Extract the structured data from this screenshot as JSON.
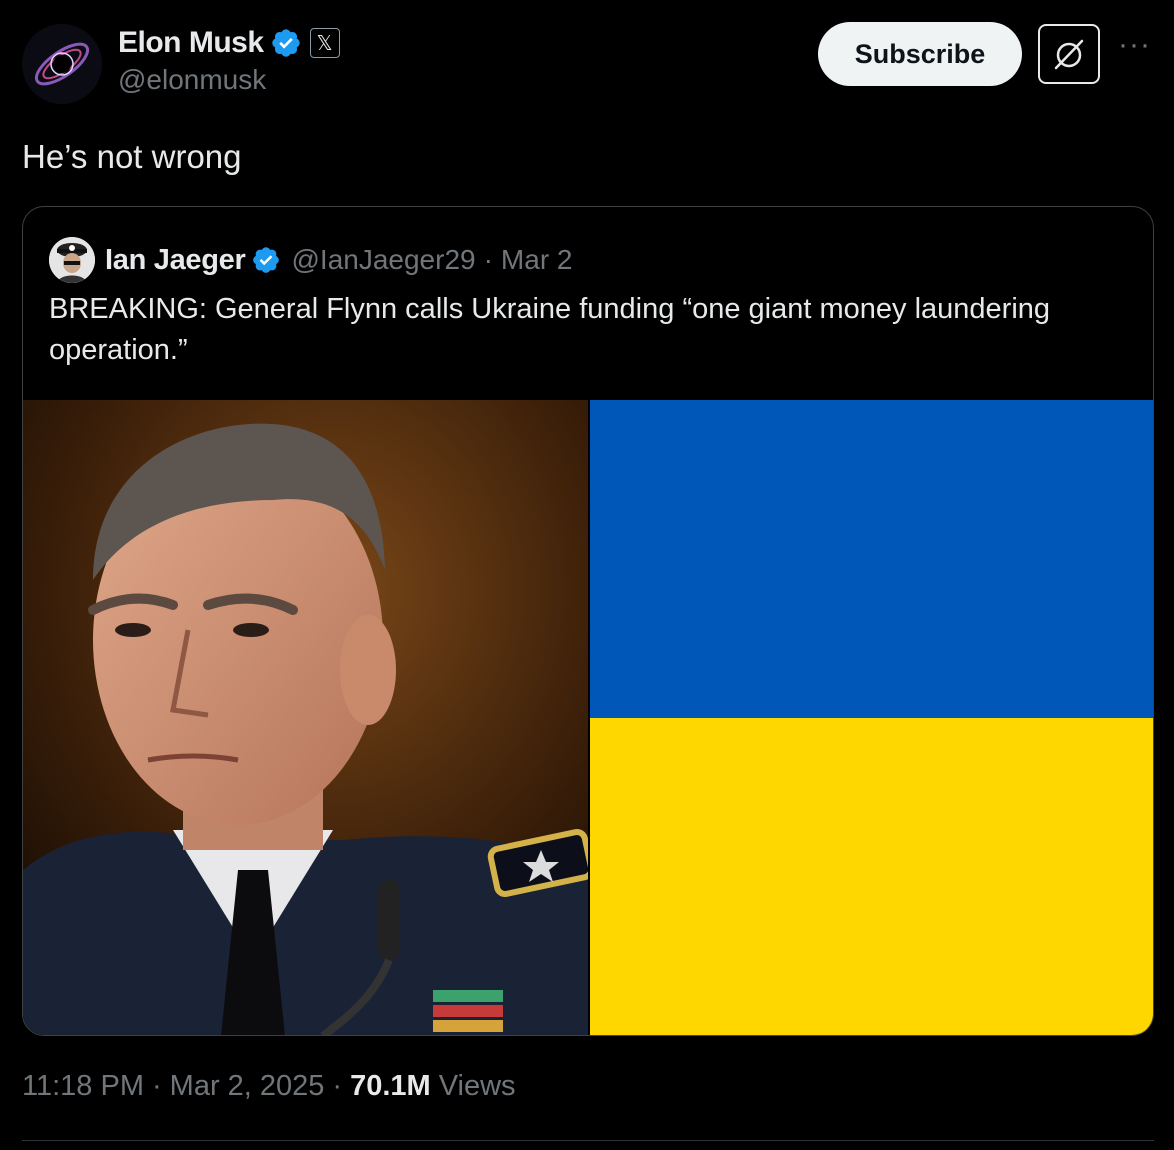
{
  "author": {
    "name": "Elon Musk",
    "handle": "@elonmusk",
    "affiliation_badge": "𝕏"
  },
  "header_actions": {
    "subscribe_label": "Subscribe",
    "grok_icon": "grok-icon",
    "more_label": "···"
  },
  "tweet": {
    "text": "He’s not wrong"
  },
  "quoted_tweet": {
    "author_name": "Ian Jaeger",
    "handle": "@IanJaeger29",
    "separator": "·",
    "date": "Mar 2",
    "text": "BREAKING: General Flynn calls Ukraine funding “one giant money laundering operation.”",
    "media": [
      {
        "kind": "photo",
        "description_icon": "person-photo"
      },
      {
        "kind": "flag",
        "colors": [
          "#0057b8",
          "#ffd700"
        ]
      }
    ]
  },
  "meta": {
    "time": "11:18 PM",
    "separator": "·",
    "date": "Mar 2, 2025",
    "views_count": "70.1M",
    "views_label": "Views"
  },
  "colors": {
    "background": "#000000",
    "verified": "#1d9bf0",
    "subscribe_bg": "#eff3f4",
    "muted": "#71767b"
  }
}
